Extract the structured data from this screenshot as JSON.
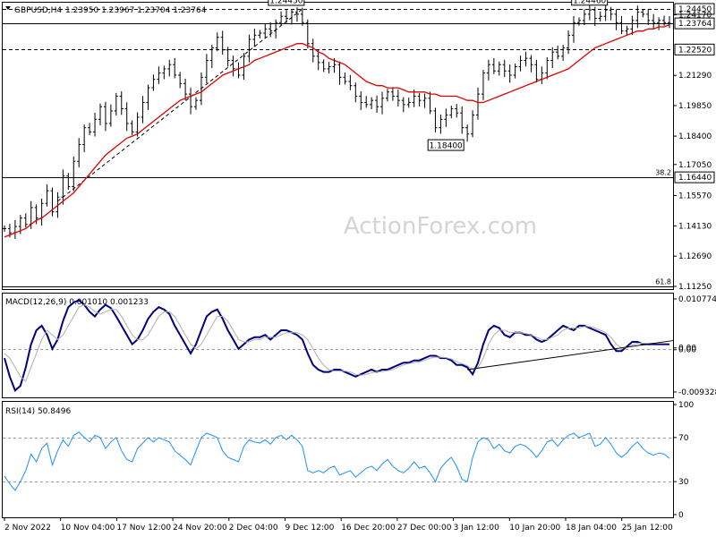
{
  "header": {
    "symbol": "GBPUSD,H4",
    "ohlc": "1.23950 1.23967 1.23704 1.23764"
  },
  "watermark": "ActionForex.com",
  "colors": {
    "candle": "#000000",
    "ma": "#e00000",
    "macd_line": "#000080",
    "macd_signal": "#b0b0b0",
    "rsi": "#1e90ff",
    "label_bg": "#ffffff"
  },
  "chart_data": [
    {
      "type": "candlestick",
      "panel": "price",
      "ylim": [
        1.1125,
        1.2462
      ],
      "y_ticks": [
        "1.24450",
        "1.24170",
        "1.23764",
        "1.22520",
        "1.21290",
        "1.19850",
        "1.18400",
        "1.17050",
        "1.16440",
        "1.15570",
        "1.14130",
        "1.12690",
        "1.11250"
      ],
      "x_ticks": [
        "2 Nov 2022",
        "10 Nov 04:00",
        "17 Nov 12:00",
        "24 Nov 20:00",
        "2 Dec 04:00",
        "9 Dec 12:00",
        "16 Dec 20:00",
        "27 Dec 00:00",
        "3 Jan 12:00",
        "10 Jan 20:00",
        "18 Jan 04:00",
        "25 Jan 12:00"
      ],
      "close_path": [
        1.14,
        1.138,
        1.141,
        1.145,
        1.142,
        1.15,
        1.145,
        1.152,
        1.158,
        1.148,
        1.155,
        1.165,
        1.16,
        1.172,
        1.18,
        1.188,
        1.186,
        1.192,
        1.198,
        1.19,
        1.196,
        1.203,
        1.197,
        1.19,
        1.186,
        1.193,
        1.2,
        1.207,
        1.211,
        1.214,
        1.216,
        1.218,
        1.213,
        1.209,
        1.204,
        1.198,
        1.201,
        1.212,
        1.22,
        1.226,
        1.231,
        1.225,
        1.22,
        1.216,
        1.213,
        1.222,
        1.23,
        1.232,
        1.233,
        1.235,
        1.234,
        1.238,
        1.241,
        1.24,
        1.243,
        1.242,
        1.238,
        1.228,
        1.222,
        1.219,
        1.216,
        1.217,
        1.218,
        1.212,
        1.21,
        1.208,
        1.203,
        1.2,
        1.199,
        1.201,
        1.198,
        1.202,
        1.205,
        1.203,
        1.201,
        1.199,
        1.2,
        1.203,
        1.201,
        1.202,
        1.196,
        1.188,
        1.192,
        1.194,
        1.197,
        1.195,
        1.188,
        1.185,
        1.194,
        1.204,
        1.214,
        1.218,
        1.215,
        1.218,
        1.215,
        1.213,
        1.217,
        1.22,
        1.221,
        1.218,
        1.211,
        1.214,
        1.22,
        1.224,
        1.222,
        1.226,
        1.232,
        1.238,
        1.239,
        1.242,
        1.244,
        1.24,
        1.241,
        1.244,
        1.242,
        1.238,
        1.234,
        1.235,
        1.239,
        1.243,
        1.242,
        1.239,
        1.238,
        1.239,
        1.238,
        1.2376
      ],
      "moving_average": [
        1.136,
        1.137,
        1.138,
        1.139,
        1.14,
        1.142,
        1.144,
        1.145,
        1.147,
        1.149,
        1.151,
        1.153,
        1.155,
        1.157,
        1.16,
        1.163,
        1.166,
        1.169,
        1.172,
        1.175,
        1.177,
        1.179,
        1.181,
        1.183,
        1.184,
        1.185,
        1.187,
        1.189,
        1.191,
        1.193,
        1.195,
        1.197,
        1.199,
        1.201,
        1.202,
        1.203,
        1.204,
        1.205,
        1.207,
        1.209,
        1.211,
        1.213,
        1.214,
        1.215,
        1.216,
        1.217,
        1.218,
        1.22,
        1.221,
        1.222,
        1.223,
        1.224,
        1.225,
        1.226,
        1.227,
        1.228,
        1.228,
        1.227,
        1.226,
        1.224,
        1.223,
        1.221,
        1.22,
        1.219,
        1.218,
        1.216,
        1.214,
        1.212,
        1.21,
        1.209,
        1.208,
        1.208,
        1.207,
        1.207,
        1.207,
        1.206,
        1.205,
        1.205,
        1.205,
        1.205,
        1.204,
        1.204,
        1.203,
        1.203,
        1.203,
        1.203,
        1.202,
        1.201,
        1.201,
        1.2,
        1.2,
        1.201,
        1.202,
        1.203,
        1.204,
        1.205,
        1.206,
        1.207,
        1.208,
        1.209,
        1.21,
        1.211,
        1.212,
        1.213,
        1.214,
        1.215,
        1.216,
        1.218,
        1.22,
        1.222,
        1.224,
        1.226,
        1.227,
        1.228,
        1.229,
        1.23,
        1.231,
        1.232,
        1.233,
        1.234,
        1.234,
        1.235,
        1.235,
        1.236,
        1.236,
        1.237
      ],
      "horizontal_levels": [
        {
          "value": 1.2445,
          "label": "1.24450",
          "style": "dashed"
        },
        {
          "value": 1.2376,
          "label": "1.23764",
          "style": "solid"
        },
        {
          "value": 1.2252,
          "label": "1.22520",
          "style": "dashed"
        },
        {
          "value": 1.1644,
          "label": "1.16440",
          "style": "solid",
          "fib": "38.2"
        },
        {
          "value": 1.1125,
          "label": "",
          "style": "solid",
          "fib": "61.8"
        }
      ],
      "callouts": [
        {
          "label": "1.24450",
          "x_index": 56,
          "value": 1.2445
        },
        {
          "label": "1.24460",
          "x_index": 113,
          "value": 1.2446
        },
        {
          "label": "1.18400",
          "x_index": 86,
          "value": 1.184
        }
      ],
      "trendline": {
        "from": [
          10,
          1.153
        ],
        "to": [
          56,
          1.2445
        ],
        "style": "dashed"
      }
    },
    {
      "type": "line",
      "panel": "macd",
      "title": "MACD(12,26,9) 0.001010 0.001233",
      "ylim": [
        -0.009328,
        0.010774
      ],
      "y_ticks": [
        "0.010774",
        "0.00",
        "0.00",
        "-0.009328"
      ],
      "series": [
        {
          "name": "MACD",
          "values": [
            -0.002,
            -0.006,
            -0.009,
            -0.008,
            -0.004,
            0.001,
            0.004,
            0.005,
            0.003,
            0.0,
            0.002,
            0.006,
            0.009,
            0.01,
            0.0105,
            0.0095,
            0.008,
            0.007,
            0.0085,
            0.0095,
            0.0088,
            0.007,
            0.005,
            0.003,
            0.001,
            0.002,
            0.004,
            0.0065,
            0.008,
            0.009,
            0.0085,
            0.0075,
            0.005,
            0.003,
            0.001,
            -0.001,
            0.001,
            0.004,
            0.007,
            0.008,
            0.0085,
            0.0065,
            0.004,
            0.002,
            0.0,
            0.001,
            0.002,
            0.0025,
            0.0025,
            0.003,
            0.002,
            0.003,
            0.004,
            0.004,
            0.0035,
            0.003,
            0.002,
            -0.001,
            -0.0035,
            -0.0045,
            -0.005,
            -0.005,
            -0.0045,
            -0.0045,
            -0.005,
            -0.0055,
            -0.006,
            -0.0055,
            -0.005,
            -0.0045,
            -0.005,
            -0.0045,
            -0.0045,
            -0.004,
            -0.0035,
            -0.003,
            -0.003,
            -0.0025,
            -0.0025,
            -0.002,
            -0.0015,
            -0.0015,
            -0.002,
            -0.002,
            -0.0025,
            -0.0035,
            -0.0035,
            -0.004,
            -0.0055,
            -0.003,
            0.001,
            0.004,
            0.005,
            0.0045,
            0.003,
            0.0025,
            0.0035,
            0.0035,
            0.003,
            0.003,
            0.002,
            0.0015,
            0.002,
            0.003,
            0.004,
            0.005,
            0.0045,
            0.004,
            0.005,
            0.005,
            0.0045,
            0.004,
            0.0035,
            0.003,
            0.001,
            -0.0005,
            -0.0005,
            0.0005,
            0.0015,
            0.0015,
            0.001,
            0.001,
            0.001,
            0.001,
            0.001,
            0.001
          ]
        },
        {
          "name": "Signal",
          "values": [
            -0.001,
            -0.002,
            -0.004,
            -0.006,
            -0.007,
            -0.004,
            -0.001,
            0.002,
            0.004,
            0.003,
            0.002,
            0.003,
            0.005,
            0.007,
            0.009,
            0.0095,
            0.009,
            0.008,
            0.0075,
            0.008,
            0.0085,
            0.0085,
            0.007,
            0.005,
            0.003,
            0.002,
            0.002,
            0.003,
            0.005,
            0.007,
            0.008,
            0.008,
            0.007,
            0.005,
            0.003,
            0.001,
            0.0,
            0.001,
            0.003,
            0.005,
            0.007,
            0.007,
            0.006,
            0.004,
            0.002,
            0.0015,
            0.0015,
            0.002,
            0.002,
            0.0025,
            0.0025,
            0.0025,
            0.003,
            0.0035,
            0.0035,
            0.0035,
            0.003,
            0.002,
            0.0,
            -0.002,
            -0.0035,
            -0.0045,
            -0.0048,
            -0.0048,
            -0.0048,
            -0.005,
            -0.0055,
            -0.0057,
            -0.0055,
            -0.0052,
            -0.005,
            -0.0049,
            -0.0047,
            -0.0045,
            -0.004,
            -0.0035,
            -0.0032,
            -0.003,
            -0.0028,
            -0.0025,
            -0.002,
            -0.0018,
            -0.0018,
            -0.0019,
            -0.0022,
            -0.0028,
            -0.0032,
            -0.0036,
            -0.0045,
            -0.004,
            -0.002,
            0.001,
            0.003,
            0.004,
            0.004,
            0.0035,
            0.0035,
            0.0035,
            0.0033,
            0.003,
            0.0025,
            0.002,
            0.002,
            0.0025,
            0.003,
            0.004,
            0.0045,
            0.0045,
            0.0045,
            0.0048,
            0.0048,
            0.0045,
            0.004,
            0.0035,
            0.0025,
            0.001,
            0.0002,
            0.0002,
            0.0008,
            0.0012,
            0.0012,
            0.0012,
            0.0012,
            0.0012,
            0.0012,
            0.0012
          ]
        }
      ],
      "zero_line": 0,
      "trendline": {
        "from": [
          87,
          -0.0045
        ],
        "to": [
          126,
          0.001
        ]
      }
    },
    {
      "type": "line",
      "panel": "rsi",
      "title": "RSI(14) 50.8496",
      "ylim": [
        0,
        100
      ],
      "y_ticks": [
        "100",
        "70",
        "30",
        "0"
      ],
      "levels": [
        70,
        30
      ],
      "series": [
        {
          "name": "RSI",
          "values": [
            35,
            28,
            22,
            30,
            40,
            55,
            48,
            60,
            65,
            45,
            58,
            68,
            62,
            72,
            75,
            70,
            66,
            72,
            70,
            60,
            66,
            70,
            58,
            50,
            48,
            60,
            65,
            70,
            66,
            70,
            68,
            66,
            58,
            54,
            50,
            45,
            58,
            70,
            74,
            72,
            70,
            58,
            52,
            50,
            48,
            62,
            68,
            66,
            65,
            68,
            64,
            70,
            72,
            68,
            72,
            68,
            62,
            40,
            38,
            40,
            38,
            42,
            44,
            36,
            38,
            40,
            34,
            38,
            42,
            44,
            40,
            46,
            50,
            44,
            40,
            38,
            42,
            48,
            42,
            44,
            38,
            30,
            42,
            48,
            52,
            44,
            32,
            30,
            52,
            66,
            70,
            68,
            60,
            64,
            58,
            56,
            62,
            64,
            62,
            58,
            52,
            58,
            66,
            68,
            62,
            68,
            72,
            74,
            70,
            72,
            74,
            62,
            64,
            70,
            64,
            56,
            52,
            56,
            62,
            66,
            60,
            56,
            54,
            56,
            55,
            51
          ]
        }
      ]
    }
  ]
}
